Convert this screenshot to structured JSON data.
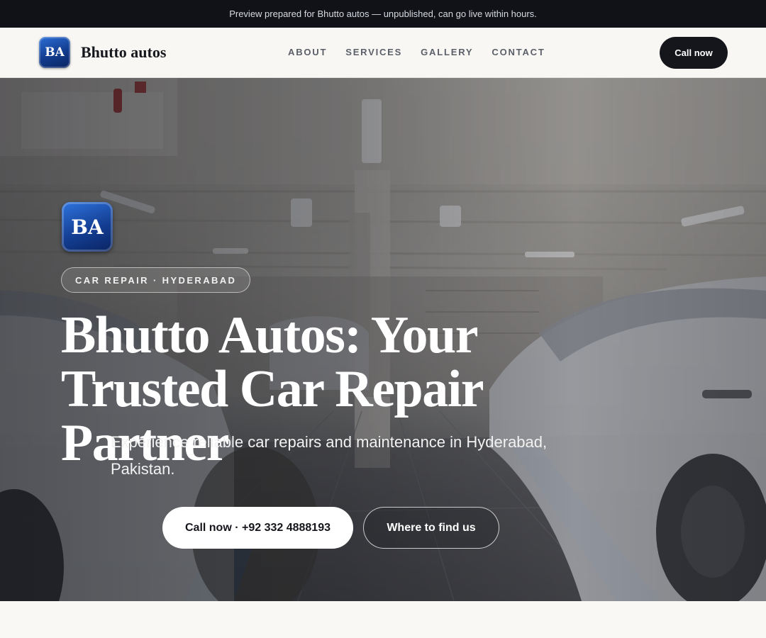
{
  "announcement": {
    "text": "Preview prepared for Bhutto autos — unpublished, can go live within hours."
  },
  "header": {
    "logo_initials": "BA",
    "brand_name": "Bhutto autos",
    "nav": [
      {
        "label": "ABOUT"
      },
      {
        "label": "SERVICES"
      },
      {
        "label": "GALLERY"
      },
      {
        "label": "CONTACT"
      }
    ],
    "cta_label": "Call now"
  },
  "hero": {
    "badge_initials": "BA",
    "eyebrow": "CAR REPAIR · HYDERABAD",
    "title_line1": "Bhutto Autos: Your",
    "title_line2": "Trusted Car Repair Partner",
    "subtitle": "Experience reliable car repairs and maintenance in Hyderabad, Pakistan.",
    "primary_button": "Call now · +92 332 4888193",
    "secondary_button": "Where to find us"
  },
  "colors": {
    "announcement_bg": "#101218",
    "header_bg": "#f8f7f4",
    "cta_bg": "#14161c",
    "logo_blue": "#123c8e",
    "page_bg": "#faf8f4"
  }
}
